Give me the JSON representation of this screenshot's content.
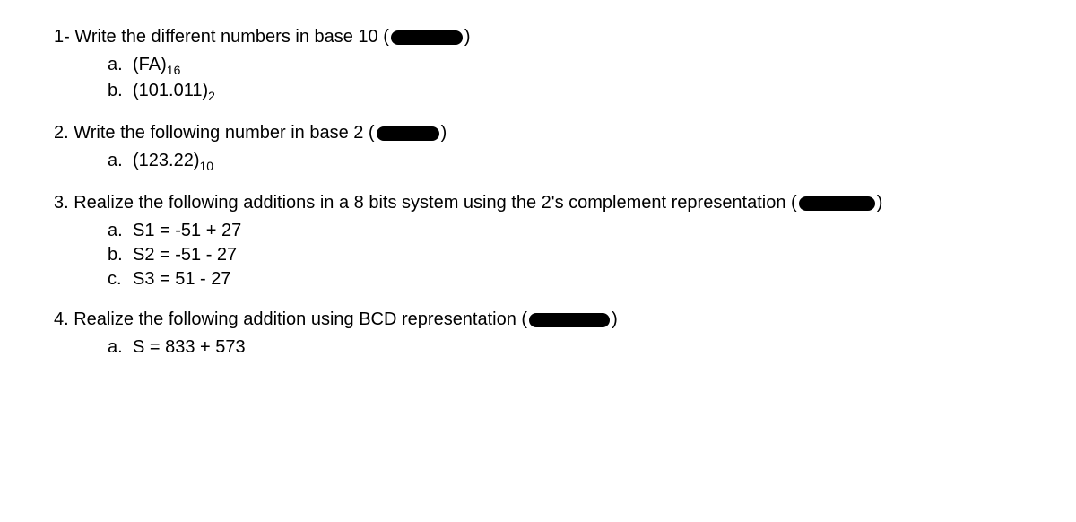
{
  "q1": {
    "title_before": "1- Write the different numbers in base 10 (",
    "title_after": ")",
    "items": [
      {
        "letter": "a.",
        "text": "(FA)",
        "sub": "16"
      },
      {
        "letter": "b.",
        "text": "(101.011)",
        "sub": "2"
      }
    ]
  },
  "q2": {
    "title_before": "2. Write the following number in base 2 (",
    "title_after": ")",
    "items": [
      {
        "letter": "a.",
        "text": "(123.22)",
        "sub": "10"
      }
    ]
  },
  "q3": {
    "title_before": "3. Realize the following additions in a 8 bits system using the 2's complement representation (",
    "title_after": ")",
    "items": [
      {
        "letter": "a.",
        "text": "S1 = -51 + 27"
      },
      {
        "letter": "b.",
        "text": "S2 = -51 - 27"
      },
      {
        "letter": "c.",
        "text": "S3 = 51 - 27"
      }
    ]
  },
  "q4": {
    "title_before": "4. Realize the following addition using BCD representation (",
    "title_after": ")",
    "items": [
      {
        "letter": "a.",
        "text": "S = 833 + 573"
      }
    ]
  }
}
